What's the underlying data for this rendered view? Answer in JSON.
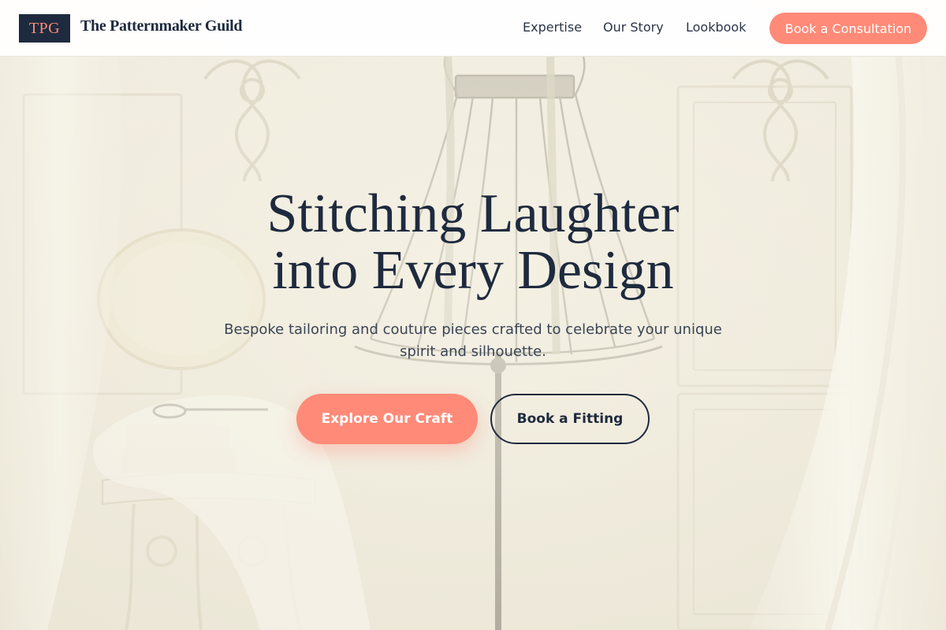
{
  "header": {
    "logo_text": "TPG",
    "brand_name": "The Patternmaker Guild",
    "nav": [
      {
        "label": "Expertise"
      },
      {
        "label": "Our Story"
      },
      {
        "label": "Lookbook"
      }
    ],
    "cta_label": "Book a Consultation"
  },
  "hero": {
    "title_line1": "Stitching Laughter",
    "title_line2": "into Every Design",
    "subtitle": "Bespoke tailoring and couture pieces crafted to celebrate your unique spirit and silhouette.",
    "primary_cta": "Explore Our Craft",
    "secondary_cta": "Book a Fitting"
  },
  "colors": {
    "accent": "#ff8a78",
    "navy": "#1e2a3e",
    "background": "#f3efe2"
  },
  "icons": {
    "logo": "tpg-monogram",
    "backdrop": "dress-form-studio-scene"
  }
}
